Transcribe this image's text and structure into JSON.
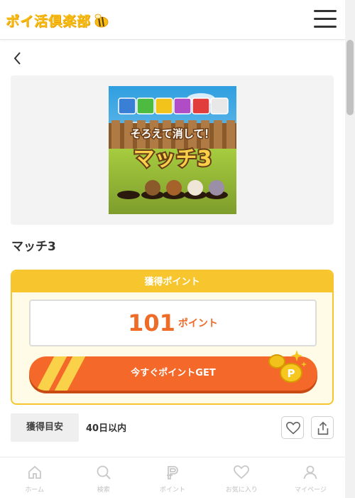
{
  "header": {
    "logo_text": "ポイ活倶楽部",
    "menu_icon": "hamburger-menu-icon"
  },
  "game": {
    "title": "マッチ3",
    "thumb_caption": "そろえて消して！",
    "thumb_title": "マッチ3"
  },
  "points": {
    "heading": "獲得ポイント",
    "value": "101",
    "unit": "ポイント",
    "button_label": "今すぐポイントGET"
  },
  "estimate": {
    "label": "獲得目安",
    "value": "40日以内"
  },
  "nav": [
    {
      "label": "ホーム",
      "icon": "home-icon"
    },
    {
      "label": "検索",
      "icon": "search-icon"
    },
    {
      "label": "ポイント",
      "icon": "point-icon"
    },
    {
      "label": "お気に入り",
      "icon": "heart-icon"
    },
    {
      "label": "マイページ",
      "icon": "user-icon"
    }
  ],
  "colors": {
    "brand_yellow": "#f7c62f",
    "accent_orange": "#f4692a",
    "point_text": "#ee6b28"
  }
}
